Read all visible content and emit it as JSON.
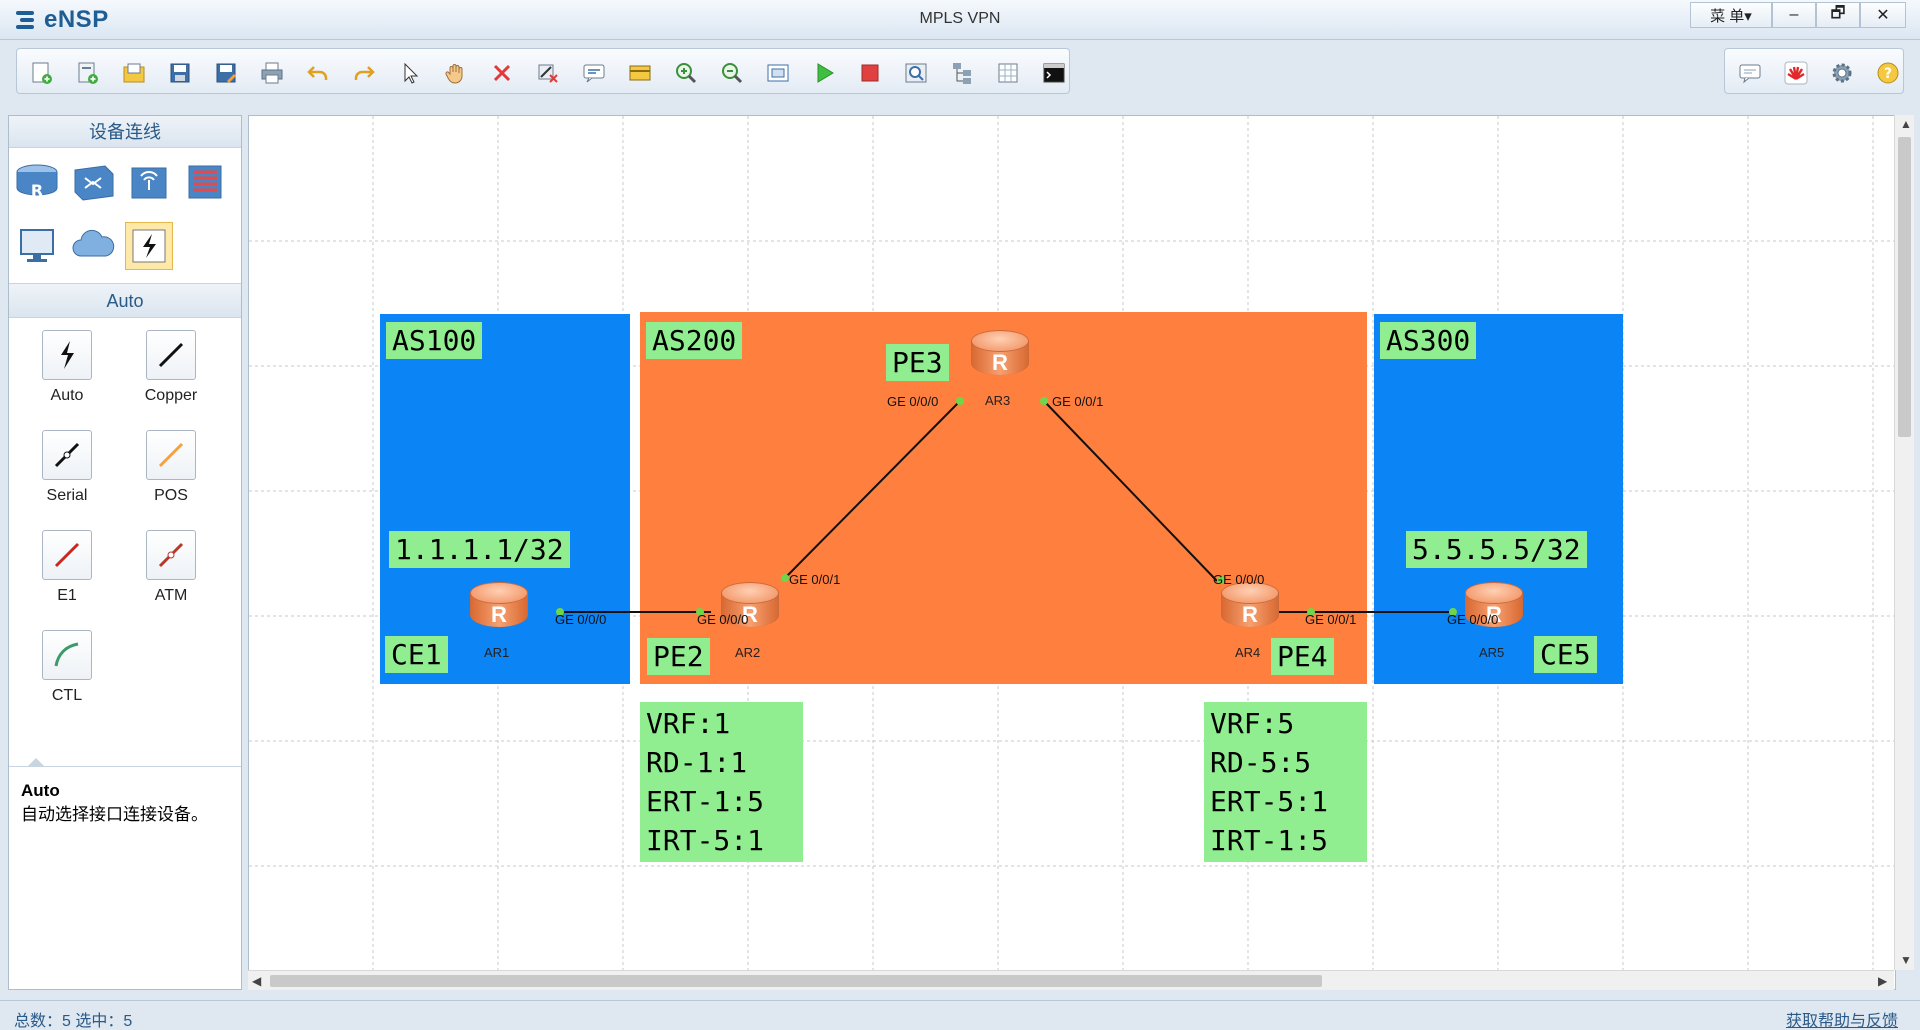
{
  "app": {
    "logo": "eNSP",
    "title": "MPLS VPN",
    "menu": "菜 单▾"
  },
  "window_buttons": [
    "–",
    "🗗",
    "✕"
  ],
  "left_panel": {
    "devices_header": "设备连线",
    "auto_header": "Auto",
    "cables": [
      "Auto",
      "Copper",
      "Serial",
      "POS",
      "E1",
      "ATM",
      "CTL"
    ],
    "desc_title": "Auto",
    "desc_text": "自动选择接口连接设备。"
  },
  "status": {
    "left": "总数：5 选中：5",
    "help": "获取帮助与反馈"
  },
  "topology": {
    "areas": [
      {
        "label": "AS100",
        "color": "#0b84f5"
      },
      {
        "label": "AS200",
        "color": "#ff7f3f"
      },
      {
        "label": "AS300",
        "color": "#0b84f5"
      }
    ],
    "routers": [
      {
        "name": "AR1",
        "tag": "CE1"
      },
      {
        "name": "AR2",
        "tag": "PE2"
      },
      {
        "name": "AR3",
        "tag": "PE3"
      },
      {
        "name": "AR4",
        "tag": "PE4"
      },
      {
        "name": "AR5",
        "tag": "CE5"
      }
    ],
    "addresses": {
      "ce1": "1.1.1.1/32",
      "ce5": "5.5.5.5/32"
    },
    "interfaces": {
      "ar1_g0": "GE 0/0/0",
      "ar2_g0": "GE 0/0/0",
      "ar2_g1": "GE 0/0/1",
      "ar3_g0": "GE 0/0/0",
      "ar3_g1": "GE 0/0/1",
      "ar4_g0": "GE 0/0/0",
      "ar4_g1": "GE 0/0/1",
      "ar5_g0": "GE 0/0/0"
    },
    "vrf_pe2": [
      "VRF:1",
      "RD-1:1",
      "ERT-1:5",
      "IRT-5:1"
    ],
    "vrf_pe4": [
      "VRF:5",
      "RD-5:5",
      "ERT-5:1",
      "IRT-1:5"
    ]
  }
}
